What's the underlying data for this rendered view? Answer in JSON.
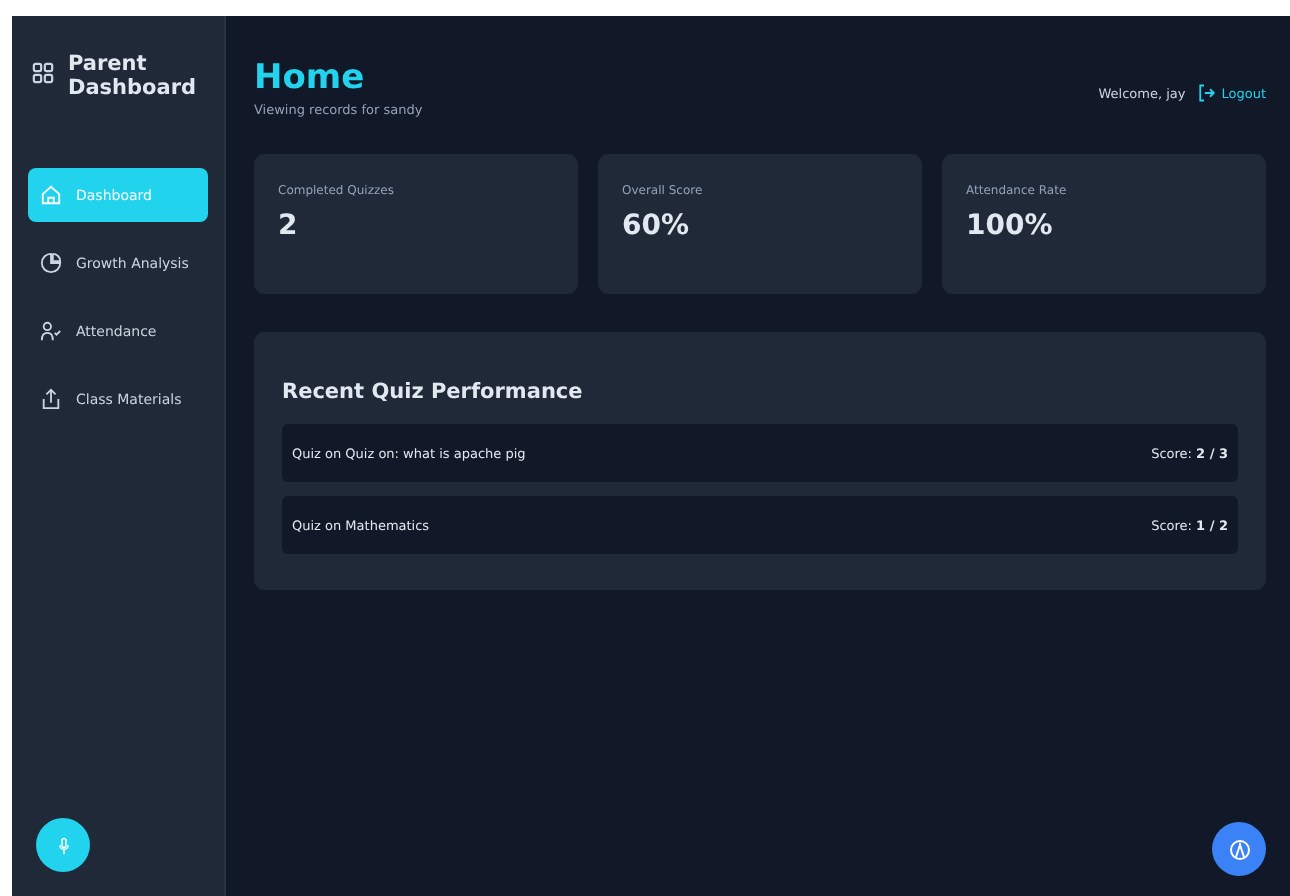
{
  "sidebar": {
    "title": "Parent Dashboard",
    "items": [
      {
        "label": "Dashboard",
        "kind": "home",
        "selected": true
      },
      {
        "label": "Growth Analysis",
        "kind": "chart",
        "selected": false
      },
      {
        "label": "Attendance",
        "kind": "attendance",
        "selected": false
      },
      {
        "label": "Class Materials",
        "kind": "materials",
        "selected": false
      }
    ]
  },
  "header": {
    "title": "Home",
    "subtitle": "Viewing records for sandy",
    "welcome": "Welcome, jay",
    "logout": "Logout"
  },
  "stats": [
    {
      "label": "Completed Quizzes",
      "value": "2"
    },
    {
      "label": "Overall Score",
      "value": "60%"
    },
    {
      "label": "Attendance Rate",
      "value": "100%"
    }
  ],
  "recent": {
    "title": "Recent Quiz Performance",
    "rows": [
      {
        "name": "Quiz on Quiz on: what is apache pig",
        "score": "Score: **2 / 3**"
      },
      {
        "name": "Quiz on Mathematics",
        "score": "Score: **1 / 2**"
      }
    ]
  }
}
